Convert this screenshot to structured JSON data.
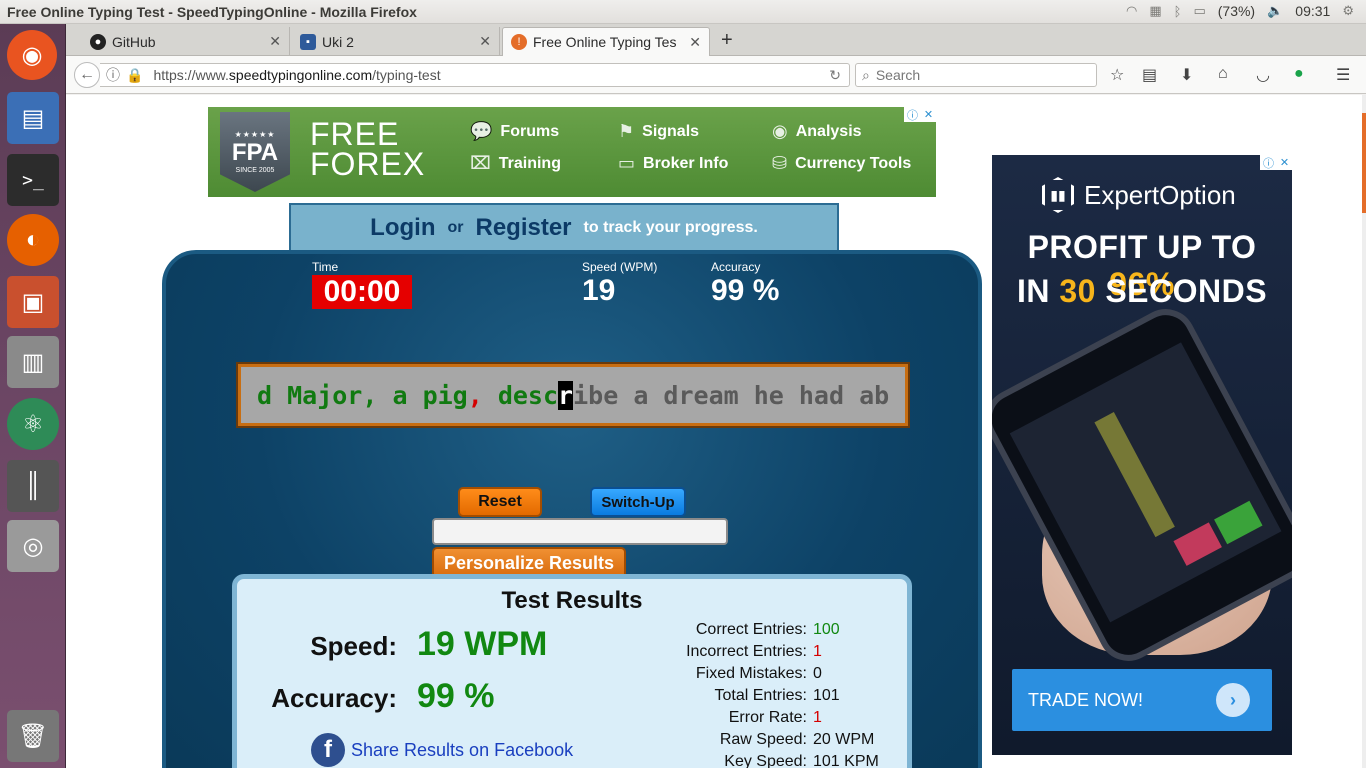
{
  "os": {
    "window_title": "Free Online Typing Test - SpeedTypingOnline - Mozilla Firefox",
    "battery": "(73%)",
    "clock": "09:31"
  },
  "tabs": [
    {
      "label": "GitHub",
      "icon": "github-icon"
    },
    {
      "label": "Uki 2",
      "icon": "uki-icon"
    },
    {
      "label": "Free Online Typing Tes",
      "icon": "speedtyping-icon",
      "active": true
    }
  ],
  "nav": {
    "url_scheme": "https://www.",
    "url_host": "speedtypingonline.com",
    "url_path": "/typing-test",
    "search_placeholder": "Search"
  },
  "ad_top": {
    "badge_stars": "★★★★★",
    "badge_text": "FPA",
    "badge_since": "SINCE 2005",
    "brand_line1": "FREE",
    "brand_line2": "FOREX",
    "links": [
      "Forums",
      "Signals",
      "Analysis",
      "Training",
      "Broker Info",
      "Currency Tools"
    ]
  },
  "login": {
    "login_label": "Login",
    "or_label": "or",
    "register_label": "Register",
    "track_label": "to track your progress."
  },
  "stats": {
    "time_label": "Time",
    "time_value": "00:00",
    "speed_label": "Speed (WPM)",
    "speed_value": "19",
    "accuracy_label": "Accuracy",
    "accuracy_value": "99 %"
  },
  "typing": {
    "typed_1": "d Major, a pig",
    "typed_error": ",",
    "typed_2": " desc",
    "cursor_char": "r",
    "remaining": "ibe a dream he had ab"
  },
  "buttons": {
    "reset": "Reset",
    "switch_up": "Switch-Up",
    "personalize": "Personalize Results"
  },
  "results": {
    "title": "Test Results",
    "speed_label": "Speed:",
    "speed_value": "19 WPM",
    "accuracy_label": "Accuracy:",
    "accuracy_value": "99 %",
    "share": "Share Results on Facebook",
    "details": [
      {
        "label": "Correct Entries:",
        "value": "100",
        "color": "green"
      },
      {
        "label": "Incorrect Entries:",
        "value": "1",
        "color": "red"
      },
      {
        "label": "Fixed Mistakes:",
        "value": "0",
        "color": ""
      },
      {
        "label": "Total Entries:",
        "value": "101",
        "color": ""
      },
      {
        "label": "Error Rate:",
        "value": "1",
        "color": "red"
      },
      {
        "label": "Raw Speed:",
        "value": "20 WPM",
        "color": ""
      },
      {
        "label": "Key Speed:",
        "value": "101 KPM",
        "color": ""
      }
    ]
  },
  "ad_side": {
    "brand": "ExpertOption",
    "headline_1": "PROFIT UP TO ",
    "headline_1_hl": "96%",
    "headline_2a": "IN ",
    "headline_2_hl": "30",
    "headline_2b": " SECONDS",
    "cta": "TRADE NOW!"
  }
}
